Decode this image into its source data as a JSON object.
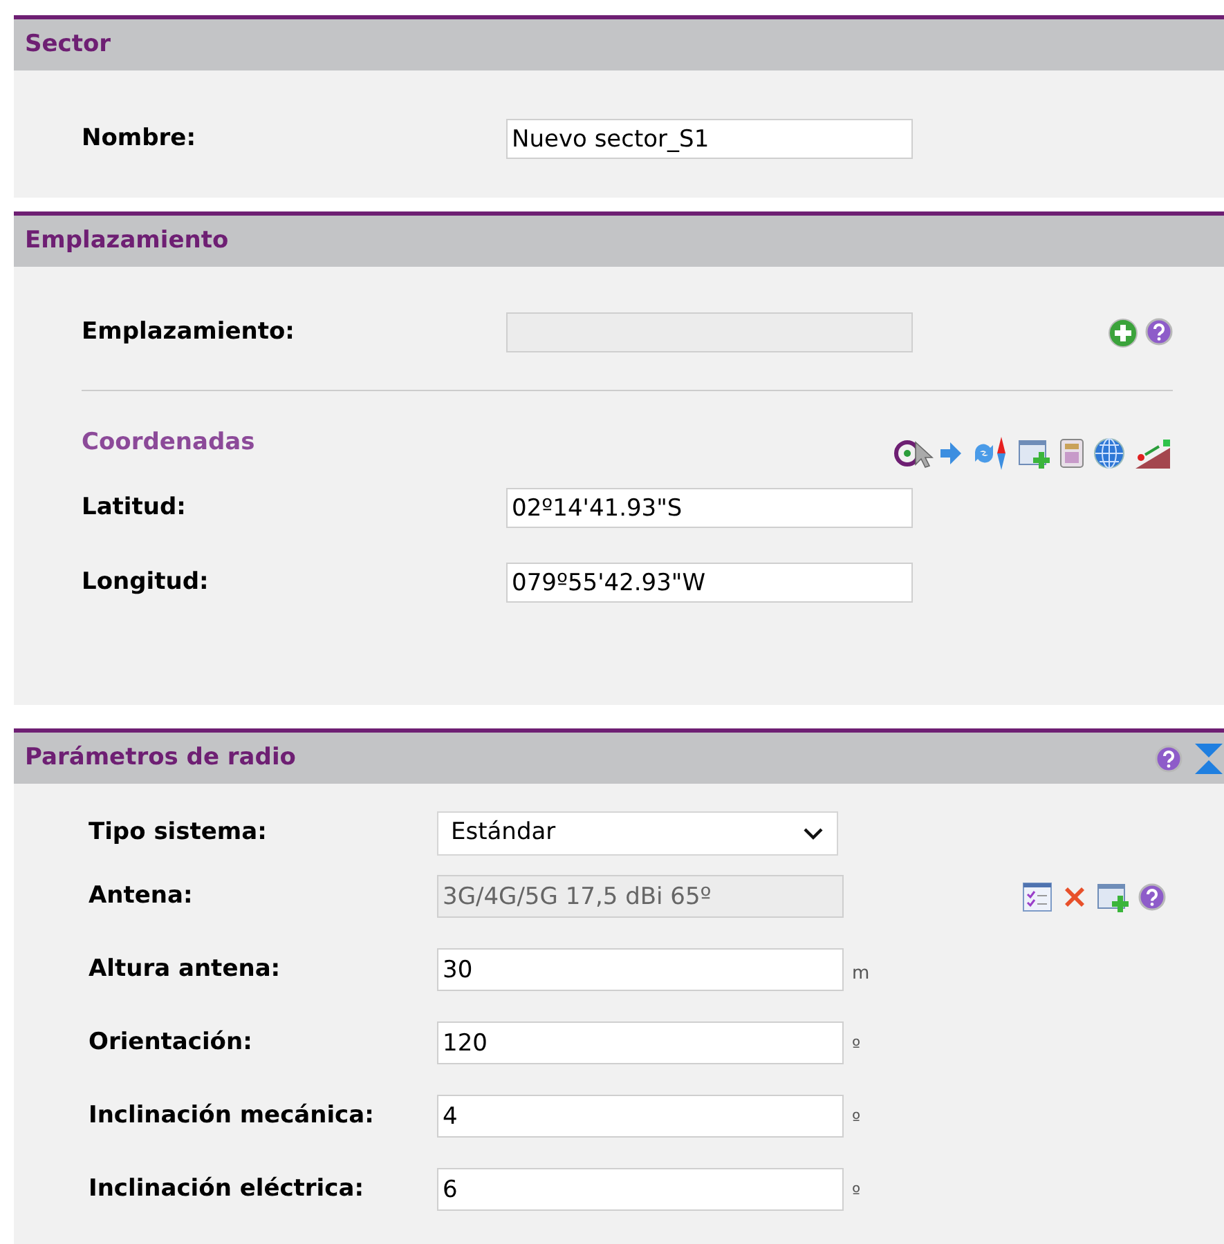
{
  "sector": {
    "title": "Sector",
    "fields": [
      {
        "label": "Nombre:",
        "value": "Nuevo sector_S1",
        "disabled": false
      }
    ]
  },
  "emplazamiento": {
    "title": "Emplazamiento",
    "fields": [
      {
        "label": "Emplazamiento:",
        "disabled": true
      }
    ],
    "coordinates": {
      "title": "Coordenadas",
      "fields": [
        {
          "label": "Latitud:",
          "value": "02º14'41.93\"S",
          "disabled": false
        },
        {
          "label": "Longitud:",
          "value": "079º55'42.93\"W",
          "disabled": false
        }
      ]
    }
  },
  "radio": {
    "title": "Parámetros de radio",
    "fields": [
      {
        "kind": "select",
        "label": "Tipo sistema:",
        "value": "Estándar",
        "disabled": false
      },
      {
        "kind": "input",
        "label": "Antena:",
        "value": "3G/4G/5G 17,5 dBi 65º",
        "disabled": true
      },
      {
        "kind": "input",
        "label": "Altura antena:",
        "value": "30",
        "unit": "m",
        "disabled": false
      },
      {
        "kind": "input",
        "label": "Orientación:",
        "value": "120",
        "unit": "º",
        "disabled": false
      },
      {
        "kind": "input",
        "label": "Inclinación mecánica:",
        "value": "4",
        "unit": "º",
        "disabled": false
      },
      {
        "kind": "input",
        "label": "Inclinación eléctrica:",
        "value": "6",
        "unit": "º",
        "disabled": false
      }
    ]
  }
}
